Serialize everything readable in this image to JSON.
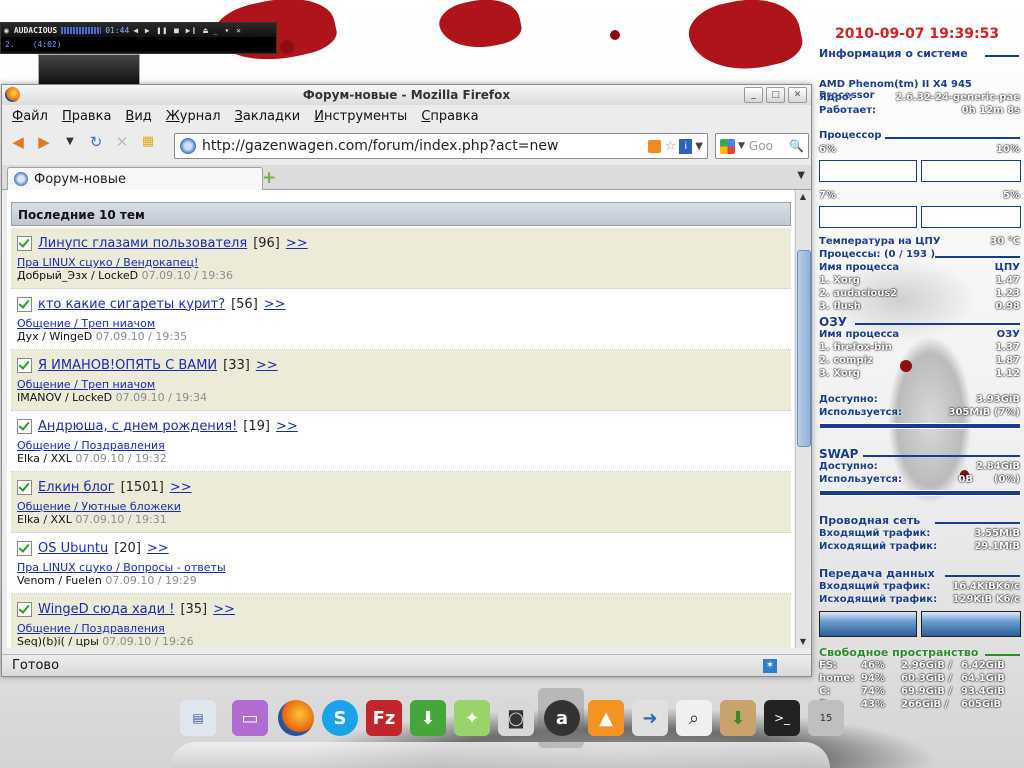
{
  "audacious": {
    "title": "AUDACIOUS",
    "time": "01:44",
    "track_no": "2.",
    "track_len": "(4:02)",
    "controls": "◀ ▶ ❚❚ ■ ▶❙ ⏏",
    "window_btns": "_ ▾ ✕"
  },
  "firefox": {
    "window_title": "Форум-новые - Mozilla Firefox",
    "window_buttons": [
      "_",
      "□",
      "✕"
    ],
    "menu": [
      "Файл",
      "Правка",
      "Вид",
      "Журнал",
      "Закладки",
      "Инструменты",
      "Справка"
    ],
    "url": "http://gazenwagen.com/forum/index.php?act=new",
    "search_placeholder": "Goo",
    "tab_label": "Форум-новые",
    "new_tab": "+",
    "section_title": "Последние 10 тем",
    "topics": [
      {
        "title": "Линупс глазами пользователя",
        "count": "[96]",
        "more": ">>",
        "category": "Пра LINUX сцуко / Вендокапец!",
        "author": "Добрый_Эзх / LockeD",
        "date": "07.09.10 / 19:36"
      },
      {
        "title": "кто какие сигареты курит?",
        "count": "[56]",
        "more": ">>",
        "category": "Общение / Треп ниачом",
        "author": "Дух / WingeD",
        "date": "07.09.10 / 19:35"
      },
      {
        "title": "Я ИМАНОВ!ОПЯТЬ С ВАМИ",
        "count": "[33]",
        "more": ">>",
        "category": "Общение / Треп ниачом",
        "author": "IMANOV / LockeD",
        "date": "07.09.10 / 19:34"
      },
      {
        "title": "Андрюша, с днем рождения!",
        "count": "[19]",
        "more": ">>",
        "category": "Общение / Поздравления",
        "author": "Elka / XXL",
        "date": "07.09.10 / 19:32"
      },
      {
        "title": "Елкин блог",
        "count": "[1501]",
        "more": ">>",
        "category": "Общение / Уютные бложеки",
        "author": "Elka / XXL",
        "date": "07.09.10 / 19:31"
      },
      {
        "title": "OS Ubuntu",
        "count": "[20]",
        "more": ">>",
        "category": "Пра LINUX сцуко / Вопросы - ответы",
        "author": "Venom / Fuelen",
        "date": "07.09.10 / 19:29"
      },
      {
        "title": "WingeD сюда хади !",
        "count": "[35]",
        "more": ">>",
        "category": "Общение / Поздравления",
        "author": "Seq)(b)i( / цры",
        "date": "07.09.10 / 19:26"
      }
    ],
    "status": "Готово"
  },
  "conky": {
    "datetime": "2010-09-07 19:39:53",
    "sysinfo_header": "Информация о системе",
    "cpu_model": "AMD Phenom(tm) II X4 945 Processor",
    "kernel_label": "Ядро:",
    "kernel": "2.6.32-24-generic-pae",
    "uptime_label": "Работает:",
    "uptime": "0h 12m 8s",
    "cpu_header": "Процессор",
    "cpu1": "6%",
    "cpu2": "10%",
    "cpu3": "7%",
    "cpu4": "5%",
    "temp_label": "Температура на ЦПУ",
    "temp": "30 °C",
    "procs_label": "Процессы: (0  / 193 )",
    "proc_name_h": "Имя процесса",
    "proc_cpu_h": "ЦПУ",
    "cpu_procs": [
      {
        "name": "1. Xorg",
        "val": "1.47"
      },
      {
        "name": "2. audacious2",
        "val": "1.23"
      },
      {
        "name": "3. flush",
        "val": "0.98"
      }
    ],
    "ram_header": "ОЗУ",
    "ram_name_h": "Имя процесса",
    "ram_h": "ОЗУ",
    "ram_procs": [
      {
        "name": "1. firefox-bin",
        "val": "1.37"
      },
      {
        "name": "2. compiz",
        "val": "1.87"
      },
      {
        "name": "3. Xorg",
        "val": "1.12"
      }
    ],
    "ram_avail_label": "Доступно:",
    "ram_avail": "3.93GiB",
    "ram_used_label": "Используется:",
    "ram_used": "305MiB  (7%)",
    "swap_header": "SWAP",
    "swap_avail_label": "Доступно:",
    "swap_avail": "2.84GiB",
    "swap_used_label": "Используется:",
    "swap_used_a": "0B",
    "swap_used_b": "(0%)",
    "wired_header": "Проводная сеть",
    "in_label": "Входящий трафик:",
    "wired_in": "3.55MiB",
    "out_label": "Исходящий трафик:",
    "wired_out": "29.1MiB",
    "transfer_header": "Передача данных",
    "tr_in": "16.4KiBK6/c",
    "tr_out": "129KiB K6/c",
    "fs_header": "Свободное пространство",
    "fs": [
      {
        "name": "FS:",
        "pct": "46%",
        "used": "2.96GiB /",
        "total": "6.42GiB"
      },
      {
        "name": "home:",
        "pct": "94%",
        "used": "60.3GiB /",
        "total": "64.1GiB"
      },
      {
        "name": "C:",
        "pct": "74%",
        "used": "69.9GiB /",
        "total": "93.4GiB"
      },
      {
        "name": "D:",
        "pct": "43%",
        "used": "266GiB /",
        "total": "605GiB"
      }
    ]
  },
  "dock": {
    "trash_badge": "15"
  }
}
